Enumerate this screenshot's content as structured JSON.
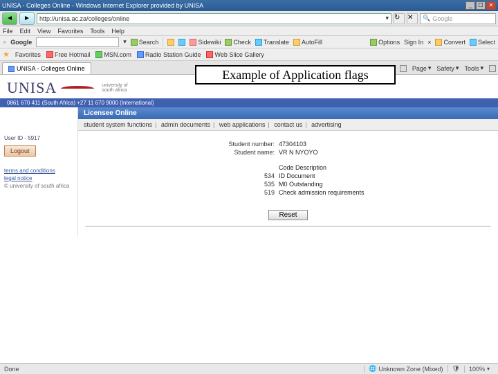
{
  "window": {
    "title": "UNISA - Colleges Online - Windows Internet Explorer provided by UNISA",
    "btn_min": "_",
    "btn_max": "☐",
    "btn_close": "✕"
  },
  "nav": {
    "back_glyph": "◄",
    "fwd_glyph": "►",
    "address": "http://unisa.ac.za/colleges/online",
    "refresh_glyph": "↻",
    "stop_glyph": "✕",
    "search_placeholder": "Google"
  },
  "menu": {
    "file": "File",
    "edit": "Edit",
    "view": "View",
    "favorites": "Favorites",
    "tools": "Tools",
    "help": "Help"
  },
  "gtoolbar": {
    "brand": "Google",
    "search_btn": "Search",
    "sidewiki": "Sidewiki",
    "check": "Check",
    "translate": "Translate",
    "autofill": "AutoFill",
    "options": "Options",
    "signin": "Sign In",
    "convert": "Convert",
    "select": "Select"
  },
  "favbar": {
    "label": "Favorites",
    "items": [
      "Free Hotmail",
      "MSN.com",
      "Radio Station Guide",
      "Web Slice Gallery"
    ]
  },
  "tab": {
    "title": "UNISA - Colleges Online"
  },
  "pagetools": {
    "home": "",
    "feeds": "",
    "print": "",
    "page": "Page",
    "safety": "Safety",
    "tools": "Tools"
  },
  "unisa": {
    "logo": "UNISA",
    "strap": "university of south africa",
    "contact": "0861 670 411 (South Africa) +27 11 670 9000 (International)"
  },
  "annotation": "Example of Application flags",
  "sidebar": {
    "userid": "User ID - 5917",
    "logout": "Logout",
    "terms": "terms and conditions",
    "legal": "legal notice",
    "copyright": "© university of south africa"
  },
  "content": {
    "banner": "Licensee Online",
    "subnav": [
      "student system functions",
      "admin documents",
      "web applications",
      "contact us",
      "advertising"
    ],
    "student_number_label": "Student number:",
    "student_number": "47304103",
    "student_name_label": "Student name:",
    "student_name": "VR N NYOYO",
    "code_desc_header": "Code Description",
    "codes": [
      {
        "code": "534",
        "desc": "ID Document"
      },
      {
        "code": "535",
        "desc": "M0 Outstanding"
      },
      {
        "code": "519",
        "desc": "Check admission requirements"
      }
    ],
    "reset": "Reset"
  },
  "status": {
    "done": "Done",
    "zone": "Unknown Zone (Mixed)",
    "zoom": "100%"
  }
}
